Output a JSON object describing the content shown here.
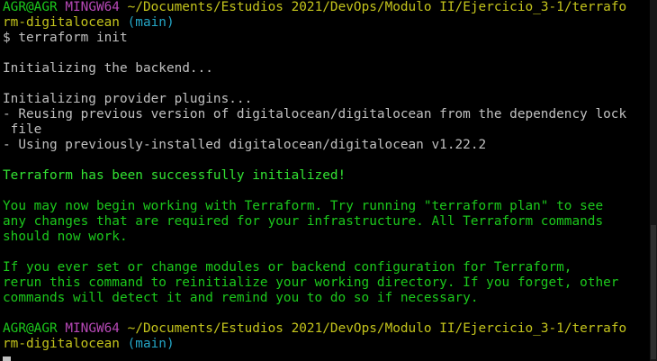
{
  "colors": {
    "background": "#000000",
    "prompt_user": "#1cc91c",
    "prompt_shell": "#b648b6",
    "prompt_path": "#c4c41c",
    "prompt_branch": "#24a6c6",
    "success": "#33e333",
    "text": "#c0c0c0"
  },
  "prompt1": {
    "user_host": "AGR@AGR",
    "shell": "MINGW64",
    "path_line1": "~/Documents/Estudios 2021/DevOps/Modulo II/Ejercicio_3-1/terrafo",
    "path_line2": "rm-digitalocean",
    "branch": "(main)"
  },
  "command": "$ terraform init",
  "output": {
    "backend": "Initializing the backend...",
    "provider": "Initializing provider plugins...",
    "reusing_1": "- Reusing previous version of digitalocean/digitalocean from the dependency lock",
    "reusing_2": " file",
    "using": "- Using previously-installed digitalocean/digitalocean v1.22.2",
    "success": "Terraform has been successfully initialized!",
    "para1_1": "You may now begin working with Terraform. Try running \"terraform plan\" to see",
    "para1_2": "any changes that are required for your infrastructure. All Terraform commands",
    "para1_3": "should now work.",
    "para2_1": "If you ever set or change modules or backend configuration for Terraform,",
    "para2_2": "rerun this command to reinitialize your working directory. If you forget, other",
    "para2_3": "commands will detect it and remind you to do so if necessary."
  },
  "prompt2": {
    "user_host": "AGR@AGR",
    "shell": "MINGW64",
    "path_line1": "~/Documents/Estudios 2021/DevOps/Modulo II/Ejercicio_3-1/terrafo",
    "path_line2": "rm-digitalocean",
    "branch": "(main)"
  }
}
